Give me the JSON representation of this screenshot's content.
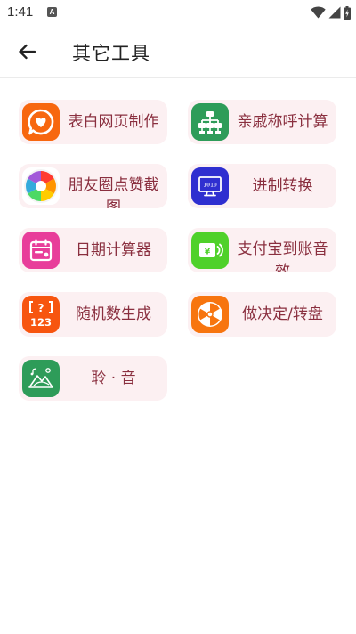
{
  "status_bar": {
    "time": "1:41",
    "notification_letter": "A"
  },
  "app_bar": {
    "title": "其它工具"
  },
  "colors": {
    "card_bg": "#fcf0f2",
    "label_text": "#8a2f3f"
  },
  "tools": [
    {
      "label": "表白网页制作",
      "icon": "speech-heart-icon",
      "color": "#f7670f"
    },
    {
      "label": "亲戚称呼计算",
      "icon": "org-tree-icon",
      "color": "#2e9c59"
    },
    {
      "label": "朋友圈点赞截图",
      "icon": "camera-aperture-icon",
      "color": "#f07a2a"
    },
    {
      "label": "进制转换",
      "icon": "monitor-binary-icon",
      "color": "#2f2fd0"
    },
    {
      "label": "日期计算器",
      "icon": "calendar-icon",
      "color": "#e83d9a"
    },
    {
      "label": "支付宝到账音效",
      "icon": "payment-sound-icon",
      "color": "#4fd12a"
    },
    {
      "label": "随机数生成",
      "icon": "random-number-icon",
      "color": "#f7550f"
    },
    {
      "label": "做决定/转盘",
      "icon": "wheel-icon",
      "color": "#f7750f"
    },
    {
      "label": "聆 · 音",
      "icon": "music-mountain-icon",
      "color": "#2e9c59"
    }
  ]
}
